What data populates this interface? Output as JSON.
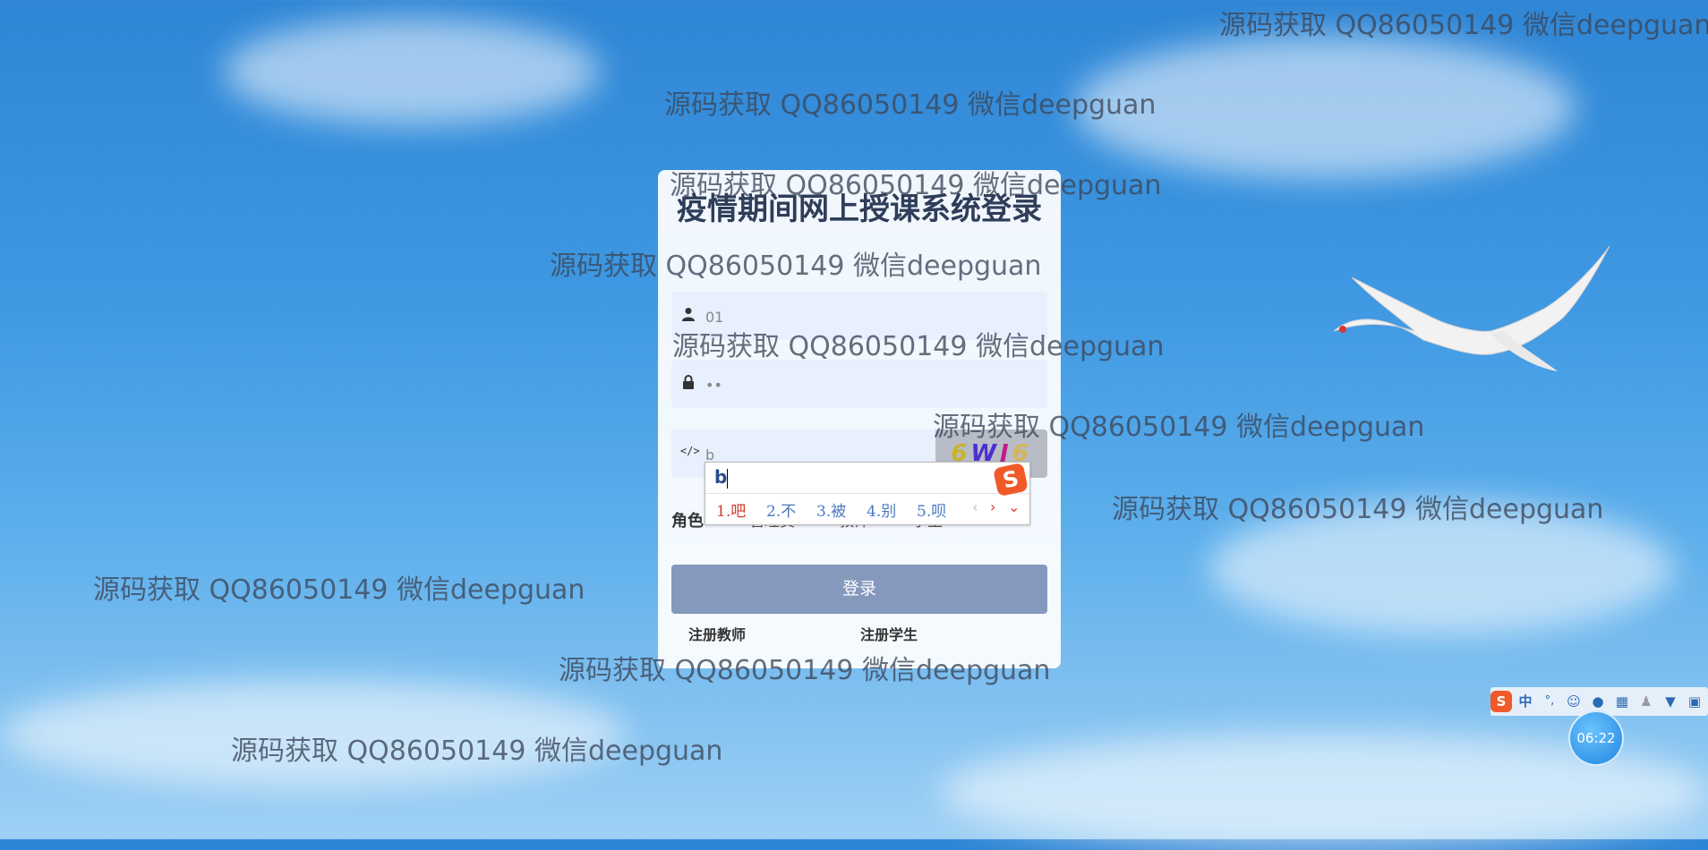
{
  "watermarks": [
    "源码获取 QQ86050149 微信deepguan",
    "源码获取 QQ86050149 微信deepguan",
    "源码获取 QQ86050149 微信deepguan",
    "源码获取 QQ86050149 微信deepguan",
    "源码获取 QQ86050149 微信deepguan",
    "源码获取 QQ86050149 微信deepguan",
    "源码获取 QQ86050149 微信deepguan",
    "源码获取 QQ86050149 微信deepguan",
    "源码获取 QQ86050149 微信deepguan",
    "源码获取 QQ86050149 微信deepguan"
  ],
  "login": {
    "title": "疫情期间网上授课系统登录",
    "username_value": "01",
    "password_value": "••",
    "captcha_value": "b",
    "captcha_image_text": "6WJ6",
    "role_label": "角色",
    "roles": [
      "管理员",
      "教师",
      "学生"
    ],
    "login_button": "登录",
    "register_teacher": "注册教师",
    "register_student": "注册学生"
  },
  "ime": {
    "composition": "b",
    "candidates": [
      "1.吧",
      "2.不",
      "3.被",
      "4.别",
      "5.呗"
    ],
    "prev": "‹",
    "next": "›",
    "expand": "⌄",
    "logo": "S"
  },
  "taskbar": {
    "ime_mode": "中",
    "punct": "°,",
    "clock": "06:22"
  },
  "colors": {
    "card_bg": "#ffffff",
    "field_bg": "#e8f0fe",
    "button_bg": "#8599bd",
    "title_color": "#2e3d59"
  }
}
